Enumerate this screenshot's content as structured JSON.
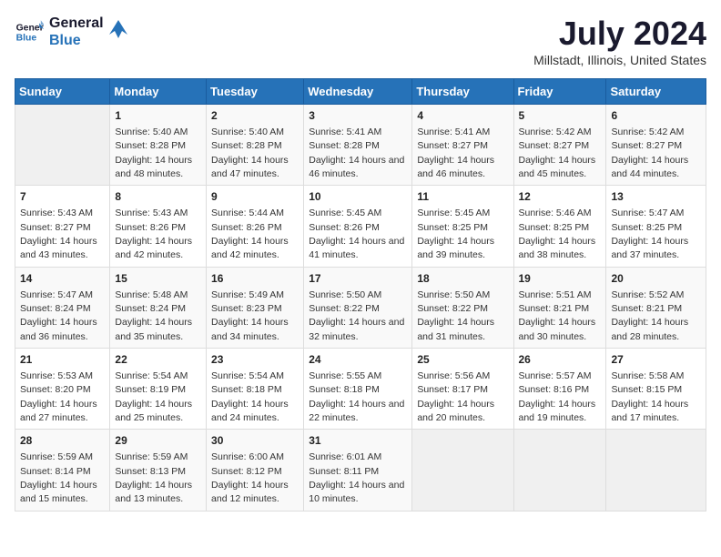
{
  "logo": {
    "line1": "General",
    "line2": "Blue"
  },
  "title": "July 2024",
  "subtitle": "Millstadt, Illinois, United States",
  "days_of_week": [
    "Sunday",
    "Monday",
    "Tuesday",
    "Wednesday",
    "Thursday",
    "Friday",
    "Saturday"
  ],
  "weeks": [
    [
      {
        "day": "",
        "empty": true
      },
      {
        "day": "1",
        "sunrise": "5:40 AM",
        "sunset": "8:28 PM",
        "daylight": "14 hours and 48 minutes."
      },
      {
        "day": "2",
        "sunrise": "5:40 AM",
        "sunset": "8:28 PM",
        "daylight": "14 hours and 47 minutes."
      },
      {
        "day": "3",
        "sunrise": "5:41 AM",
        "sunset": "8:28 PM",
        "daylight": "14 hours and 46 minutes."
      },
      {
        "day": "4",
        "sunrise": "5:41 AM",
        "sunset": "8:27 PM",
        "daylight": "14 hours and 46 minutes."
      },
      {
        "day": "5",
        "sunrise": "5:42 AM",
        "sunset": "8:27 PM",
        "daylight": "14 hours and 45 minutes."
      },
      {
        "day": "6",
        "sunrise": "5:42 AM",
        "sunset": "8:27 PM",
        "daylight": "14 hours and 44 minutes."
      }
    ],
    [
      {
        "day": "7",
        "sunrise": "5:43 AM",
        "sunset": "8:27 PM",
        "daylight": "14 hours and 43 minutes."
      },
      {
        "day": "8",
        "sunrise": "5:43 AM",
        "sunset": "8:26 PM",
        "daylight": "14 hours and 42 minutes."
      },
      {
        "day": "9",
        "sunrise": "5:44 AM",
        "sunset": "8:26 PM",
        "daylight": "14 hours and 42 minutes."
      },
      {
        "day": "10",
        "sunrise": "5:45 AM",
        "sunset": "8:26 PM",
        "daylight": "14 hours and 41 minutes."
      },
      {
        "day": "11",
        "sunrise": "5:45 AM",
        "sunset": "8:25 PM",
        "daylight": "14 hours and 39 minutes."
      },
      {
        "day": "12",
        "sunrise": "5:46 AM",
        "sunset": "8:25 PM",
        "daylight": "14 hours and 38 minutes."
      },
      {
        "day": "13",
        "sunrise": "5:47 AM",
        "sunset": "8:25 PM",
        "daylight": "14 hours and 37 minutes."
      }
    ],
    [
      {
        "day": "14",
        "sunrise": "5:47 AM",
        "sunset": "8:24 PM",
        "daylight": "14 hours and 36 minutes."
      },
      {
        "day": "15",
        "sunrise": "5:48 AM",
        "sunset": "8:24 PM",
        "daylight": "14 hours and 35 minutes."
      },
      {
        "day": "16",
        "sunrise": "5:49 AM",
        "sunset": "8:23 PM",
        "daylight": "14 hours and 34 minutes."
      },
      {
        "day": "17",
        "sunrise": "5:50 AM",
        "sunset": "8:22 PM",
        "daylight": "14 hours and 32 minutes."
      },
      {
        "day": "18",
        "sunrise": "5:50 AM",
        "sunset": "8:22 PM",
        "daylight": "14 hours and 31 minutes."
      },
      {
        "day": "19",
        "sunrise": "5:51 AM",
        "sunset": "8:21 PM",
        "daylight": "14 hours and 30 minutes."
      },
      {
        "day": "20",
        "sunrise": "5:52 AM",
        "sunset": "8:21 PM",
        "daylight": "14 hours and 28 minutes."
      }
    ],
    [
      {
        "day": "21",
        "sunrise": "5:53 AM",
        "sunset": "8:20 PM",
        "daylight": "14 hours and 27 minutes."
      },
      {
        "day": "22",
        "sunrise": "5:54 AM",
        "sunset": "8:19 PM",
        "daylight": "14 hours and 25 minutes."
      },
      {
        "day": "23",
        "sunrise": "5:54 AM",
        "sunset": "8:18 PM",
        "daylight": "14 hours and 24 minutes."
      },
      {
        "day": "24",
        "sunrise": "5:55 AM",
        "sunset": "8:18 PM",
        "daylight": "14 hours and 22 minutes."
      },
      {
        "day": "25",
        "sunrise": "5:56 AM",
        "sunset": "8:17 PM",
        "daylight": "14 hours and 20 minutes."
      },
      {
        "day": "26",
        "sunrise": "5:57 AM",
        "sunset": "8:16 PM",
        "daylight": "14 hours and 19 minutes."
      },
      {
        "day": "27",
        "sunrise": "5:58 AM",
        "sunset": "8:15 PM",
        "daylight": "14 hours and 17 minutes."
      }
    ],
    [
      {
        "day": "28",
        "sunrise": "5:59 AM",
        "sunset": "8:14 PM",
        "daylight": "14 hours and 15 minutes."
      },
      {
        "day": "29",
        "sunrise": "5:59 AM",
        "sunset": "8:13 PM",
        "daylight": "14 hours and 13 minutes."
      },
      {
        "day": "30",
        "sunrise": "6:00 AM",
        "sunset": "8:12 PM",
        "daylight": "14 hours and 12 minutes."
      },
      {
        "day": "31",
        "sunrise": "6:01 AM",
        "sunset": "8:11 PM",
        "daylight": "14 hours and 10 minutes."
      },
      {
        "day": "",
        "empty": true
      },
      {
        "day": "",
        "empty": true
      },
      {
        "day": "",
        "empty": true
      }
    ]
  ],
  "labels": {
    "sunrise_prefix": "Sunrise: ",
    "sunset_prefix": "Sunset: ",
    "daylight_prefix": "Daylight: "
  }
}
